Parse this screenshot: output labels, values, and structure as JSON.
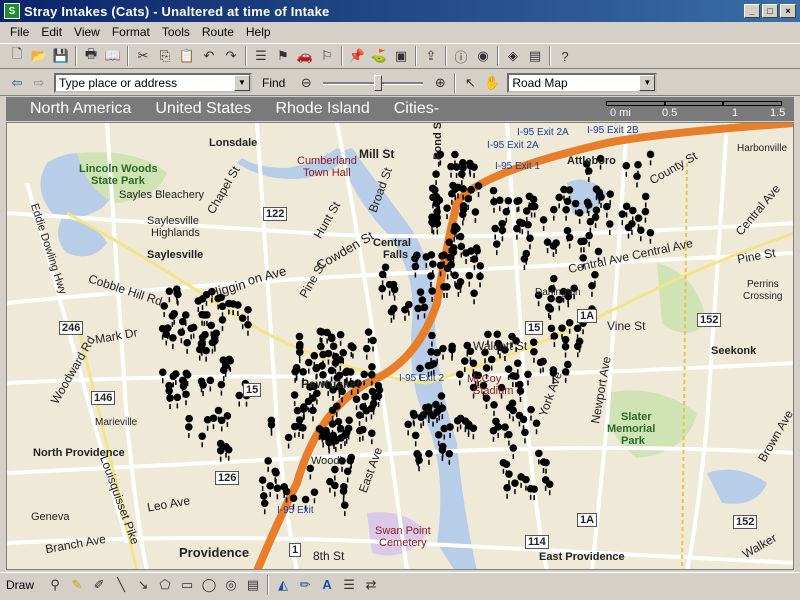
{
  "window": {
    "title": "Stray Intakes (Cats) - Unaltered at time of Intake",
    "minimize": "_",
    "maximize": "□",
    "close": "×"
  },
  "menu": [
    "File",
    "Edit",
    "View",
    "Format",
    "Tools",
    "Route",
    "Help"
  ],
  "toolbar2": {
    "search_placeholder": "Type place or address",
    "find_label": "Find",
    "zoom_level": 0.55,
    "map_style": "Road Map"
  },
  "breadcrumb": [
    "North America",
    "United States",
    "Rhode Island",
    "Cities-"
  ],
  "scale": {
    "labels": [
      "0 mi",
      "0.5",
      "1",
      "1.5"
    ]
  },
  "map_labels": {
    "lonsdale": "Lonsdale",
    "mill_st": "Mill St",
    "pond_st": "Pond St",
    "cumberland": "Cumberland",
    "town_hall": "Town Hall",
    "exit2a_1": "I-95 Exit 2A",
    "exit2b": "I-95 Exit 2B",
    "exit2a_2": "I-95 Exit 2A",
    "exit1": "I-95 Exit 1",
    "attleboro": "Attleboro",
    "harbonville": "Harbonville",
    "county_st": "County St",
    "lincoln_woods": "Lincoln Woods",
    "state_park": "State Park",
    "sayles_bleachery": "Sayles Bleachery",
    "chapel_st": "Chapel St",
    "saylesville_highlands": "Saylesville",
    "highlands": "Highlands",
    "saylesville": "Saylesville",
    "r122": "122",
    "hunt_st": "Hunt St",
    "broad_st": "Broad St",
    "central_falls": "Central",
    "falls": "Falls",
    "cowden_st": "Cowden St",
    "central_ave": "Central Ave Central Ave",
    "pine_st_e": "Pine St",
    "central_ave2": "Central Ave",
    "perrins": "Perrins",
    "crossing": "Crossing",
    "cobble_hill": "Cobble Hill Rd",
    "higgins": "Higgin",
    "on_ave": "on Ave",
    "pine_st": "Pine St",
    "darlington": "Darlington",
    "r1a_top": "1A",
    "vine_st": "Vine St",
    "r152": "152",
    "seekonk": "Seekonk",
    "r246": "246",
    "mark_dr": "Mark Dr",
    "r15": "15",
    "r15b": "15",
    "pawtucket": "Pawtucket",
    "walcott": "Walcott St",
    "exit2": "I-95 Exit 2",
    "mccoy": "McCoy",
    "stadium": "Stadium",
    "r146": "146",
    "marieville": "Marieville",
    "woodward": "Woodward Rd",
    "york_ave": "York Ave",
    "newport_ave": "Newport Ave",
    "slater": "Slater",
    "memorial": "Memorial",
    "park": "Park",
    "north_providence": "North Providence",
    "r126": "126",
    "woodlawn": "Woodl",
    "east_ave": "East Ave",
    "leo_ave": "Leo Ave",
    "exit_b": "I-95 Exit",
    "swan_point": "Swan Point",
    "cemetery": "Cemetery",
    "r1a_bot": "1A",
    "r152b": "152",
    "brown_ave": "Brown Ave",
    "geneva": "Geneva",
    "branch_ave": "Branch Ave",
    "louisquisset": "Louisquisset Pike",
    "providence": "Providence",
    "r1": "1",
    "eighth_st": "8th St",
    "r114": "114",
    "east_providence": "East Providence",
    "walker": "Walker",
    "eddie_dowling": "Eddie Dowling Hwy",
    "woodward_rd": "Woodward Rd"
  },
  "drawbar": {
    "draw_label": "Draw"
  },
  "colors": {
    "map_bg": "#efe9d8",
    "water": "#b7cde8",
    "park": "#cfe3b5",
    "highway": "#e87d2a",
    "road": "#ffffff",
    "marker": "#000000"
  }
}
